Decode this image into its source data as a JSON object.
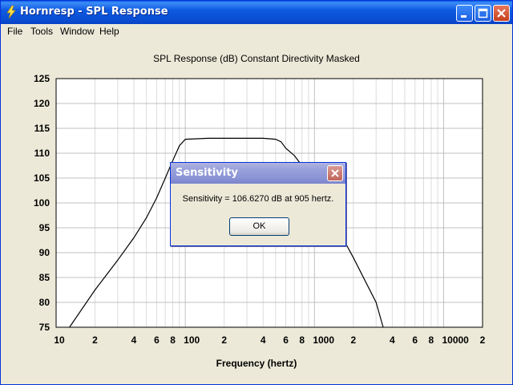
{
  "window": {
    "title": "Hornresp - SPL Response"
  },
  "menu": [
    {
      "label": "File"
    },
    {
      "label": "Tools"
    },
    {
      "label": "Window"
    },
    {
      "label": "Help"
    }
  ],
  "chart_header": "SPL Response (dB)   Constant Directivity   Masked",
  "chart_data": {
    "type": "line",
    "title": "SPL Response (dB)   Constant Directivity   Masked",
    "xlabel": "Frequency (hertz)",
    "ylabel": "",
    "x_scale": "log",
    "xlim": [
      10,
      20000
    ],
    "ylim": [
      75,
      125
    ],
    "y_ticks": [
      75,
      80,
      85,
      90,
      95,
      100,
      105,
      110,
      115,
      120,
      125
    ],
    "x_tick_labels": [
      {
        "x": 10,
        "label": "10"
      },
      {
        "x": 20,
        "label": "2"
      },
      {
        "x": 40,
        "label": "4"
      },
      {
        "x": 60,
        "label": "6"
      },
      {
        "x": 80,
        "label": "8"
      },
      {
        "x": 100,
        "label": "100"
      },
      {
        "x": 200,
        "label": "2"
      },
      {
        "x": 400,
        "label": "4"
      },
      {
        "x": 600,
        "label": "6"
      },
      {
        "x": 800,
        "label": "8"
      },
      {
        "x": 1000,
        "label": "1000"
      },
      {
        "x": 2000,
        "label": "2"
      },
      {
        "x": 4000,
        "label": "4"
      },
      {
        "x": 6000,
        "label": "6"
      },
      {
        "x": 8000,
        "label": "8"
      },
      {
        "x": 10000,
        "label": "10000"
      },
      {
        "x": 20000,
        "label": "2"
      }
    ],
    "grid": true,
    "series": [
      {
        "x": [
          12.7,
          20,
          30,
          40,
          50,
          60,
          70,
          80,
          90,
          100,
          150,
          200,
          300,
          400,
          500,
          550,
          600,
          700,
          800,
          1000,
          1500,
          2000,
          3000,
          3400
        ],
        "values": [
          75,
          82.5,
          88.5,
          93,
          97,
          101,
          105,
          108.5,
          111.5,
          112.8,
          113,
          113,
          113,
          113,
          112.8,
          112.3,
          111,
          109.5,
          107.5,
          103.5,
          95,
          89,
          80,
          75
        ]
      }
    ],
    "colors": {
      "line": "#000000",
      "grid_major": "#C0C0C0",
      "grid_minor": "#DCDCDC",
      "plot_bg": "#FFFFFF"
    }
  },
  "dialog": {
    "title": "Sensitivity",
    "message": "Sensitivity = 106.6270 dB at 905 hertz.",
    "ok_label": "OK"
  }
}
